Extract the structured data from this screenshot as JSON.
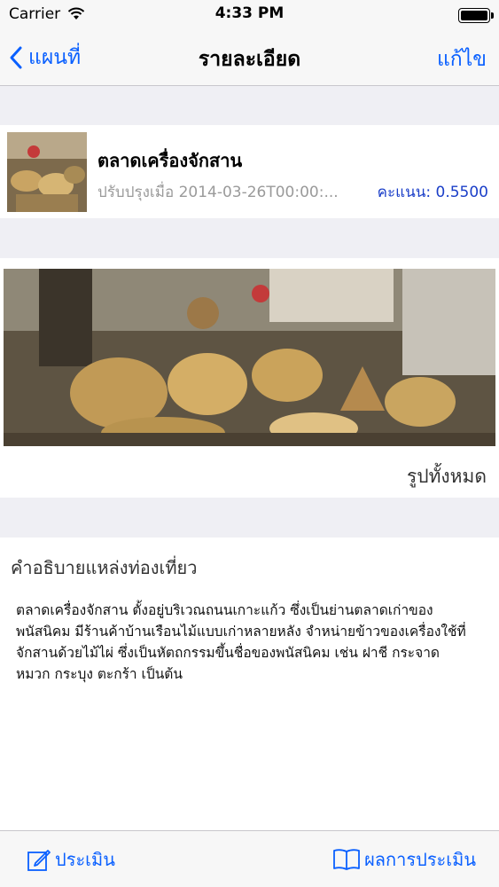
{
  "status_bar": {
    "carrier": "Carrier",
    "time": "4:33 PM"
  },
  "nav": {
    "back_label": "แผนที่",
    "title": "รายละเอียด",
    "edit_label": "แก้ไข"
  },
  "place": {
    "name": "ตลาดเครื่องจักสาน",
    "updated": "ปรับปรุงเมื่อ 2014-03-26T00:00:...",
    "score": "คะแนน: 0.5500"
  },
  "photos": {
    "all_label": "รูปทั้งหมด"
  },
  "description": {
    "heading": "คำอธิบายแหล่งท่องเที่ยว",
    "text": "ตลาดเครื่องจักสาน ตั้งอยู่บริเวณถนนเกาะแก้ว ซึ่งเป็นย่านตลาดเก่าของพนัสนิคม มีร้านค้าบ้านเรือนไม้แบบเก่าหลายหลัง จำหน่ายข้าวของเครื่องใช้ที่จักสานด้วยไม้ไผ่ ซึ่งเป็นหัตถกรรมขึ้นชื่อของพนัสนิคม เช่น ฝาชี กระจาด หมวก กระบุง ตะกร้า เป็นต้น"
  },
  "toolbar": {
    "rate_label": "ประเมิน",
    "results_label": "ผลการประเมิน"
  },
  "colors": {
    "accent": "#0a60ff",
    "score": "#1a3ec8",
    "background": "#efeff4"
  },
  "icons": [
    "wifi-icon",
    "battery-icon",
    "back-chevron-icon",
    "compose-icon",
    "book-icon"
  ]
}
